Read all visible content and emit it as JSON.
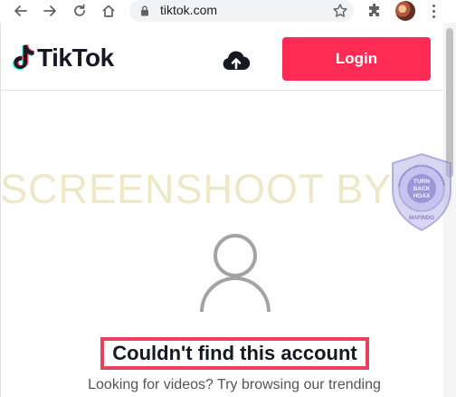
{
  "browser": {
    "url": "tiktok.com",
    "nav_icons": [
      "back-icon",
      "forward-icon",
      "reload-icon",
      "home-icon"
    ],
    "toolbar_icons": [
      "lock-icon",
      "star-icon",
      "puzzle-icon",
      "avatar",
      "menu-dots-icon"
    ]
  },
  "header": {
    "logo_text": "TikTok",
    "upload_icon": "cloud-upload-icon",
    "login_label": "Login"
  },
  "watermark": {
    "text": "SCREENSHOOT BY",
    "seal_lines": [
      "TURN",
      "BACK",
      "HOAX"
    ],
    "seal_ring_top": "MASYARAKAT ANTI FITNAH INDONESIA",
    "seal_ring_bottom": "MAFINDO"
  },
  "empty_state": {
    "icon": "user-icon",
    "title": "Couldn't find this account",
    "hint": "Looking for videos? Try browsing our trending"
  },
  "colors": {
    "brand_red": "#fe2c55",
    "highlight_border": "#e8415e",
    "watermark": "#dccd82"
  }
}
